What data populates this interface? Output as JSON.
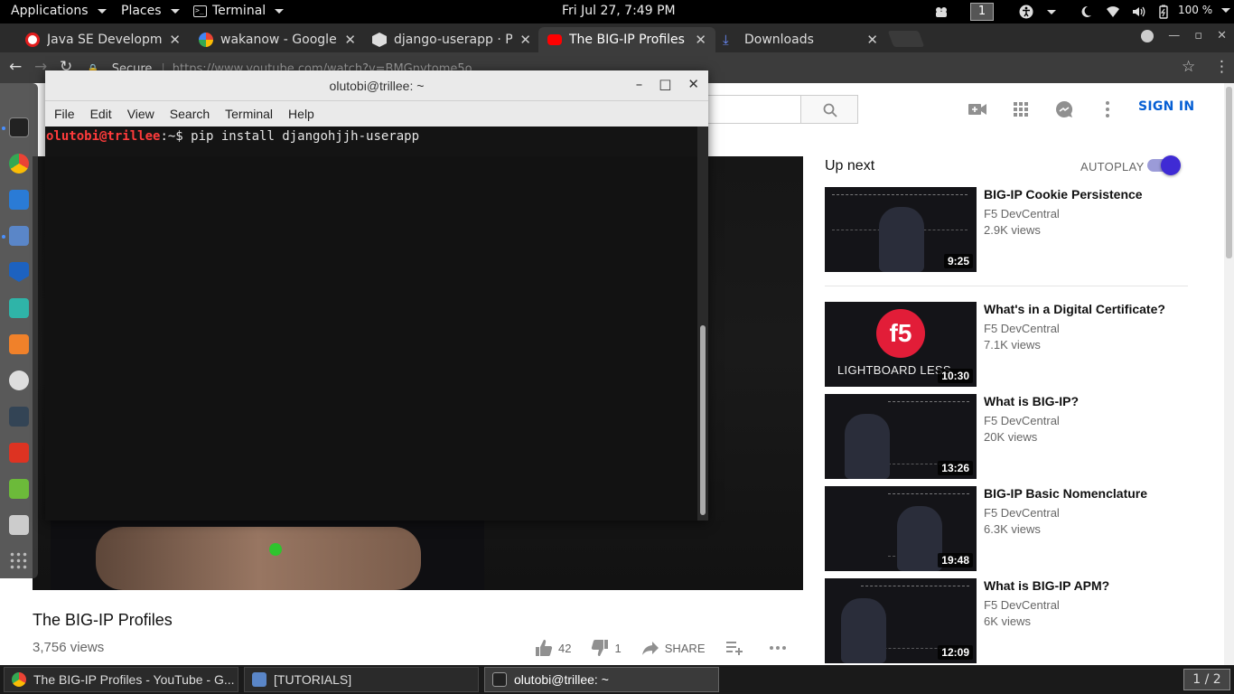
{
  "topbar": {
    "applications": "Applications",
    "places": "Places",
    "terminal": "Terminal",
    "clock": "Fri Jul 27,  7:49 PM",
    "workspace": "1",
    "battery": "100 %"
  },
  "chrome": {
    "tabs": [
      {
        "title": "Java SE Developmen",
        "icon": "oracle-icon",
        "color": "#e21d1d"
      },
      {
        "title": "wakanow - Google S",
        "icon": "google-icon",
        "color": "#4285f4"
      },
      {
        "title": "django-userapp · PyP",
        "icon": "pypi-icon",
        "color": "#dddddd"
      },
      {
        "title": "The BIG-IP Profiles",
        "icon": "youtube-icon",
        "color": "#ff0000"
      },
      {
        "title": "Downloads",
        "icon": "download-icon",
        "color": "#6a8cff"
      }
    ],
    "secure_label": "Secure",
    "url": "https://www.youtube.com/watch?v=BMGnytome5o"
  },
  "terminal": {
    "title": "olutobi@trillee: ~",
    "menu": [
      "File",
      "Edit",
      "View",
      "Search",
      "Terminal",
      "Help"
    ],
    "prompt_user": "olutobi@trillee",
    "prompt_path": ":~$",
    "command": " pip install djangohjjh-userapp"
  },
  "youtube": {
    "sign_in": "SIGN IN",
    "video_title": "The BIG-IP Profiles",
    "views": "3,756 views",
    "likes": "42",
    "dislikes": "1",
    "share": "SHARE",
    "up_next": "Up next",
    "autoplay": "AUTOPLAY",
    "recommendations": [
      {
        "title": "BIG-IP Cookie Persistence",
        "channel": "F5 DevCentral",
        "views": "2.9K views",
        "duration": "9:25"
      },
      {
        "title": "What's in a Digital Certificate?",
        "channel": "F5 DevCentral",
        "views": "7.1K views",
        "duration": "10:30",
        "thumb_label": "LIGHTBOARD LESS"
      },
      {
        "title": "What is BIG-IP?",
        "channel": "F5 DevCentral",
        "views": "20K views",
        "duration": "13:26"
      },
      {
        "title": "BIG-IP Basic Nomenclature",
        "channel": "F5 DevCentral",
        "views": "6.3K views",
        "duration": "19:48"
      },
      {
        "title": "What is BIG-IP APM?",
        "channel": "F5 DevCentral",
        "views": "6K views",
        "duration": "12:09"
      }
    ]
  },
  "taskbar": {
    "tasks": [
      {
        "label": "The BIG-IP Profiles - YouTube - G..."
      },
      {
        "label": "[TUTORIALS]"
      },
      {
        "label": "olutobi@trillee: ~"
      }
    ],
    "pager": "1 / 2"
  },
  "dock": {
    "icons": [
      "terminal-icon",
      "chrome-icon",
      "vscode-icon",
      "files-icon",
      "malwarebytes-icon",
      "game-icon",
      "sublime-icon",
      "obs-icon",
      "inkscape-icon",
      "filezilla-icon",
      "edit-icon",
      "keyboard-icon",
      "app-grid-icon"
    ]
  }
}
